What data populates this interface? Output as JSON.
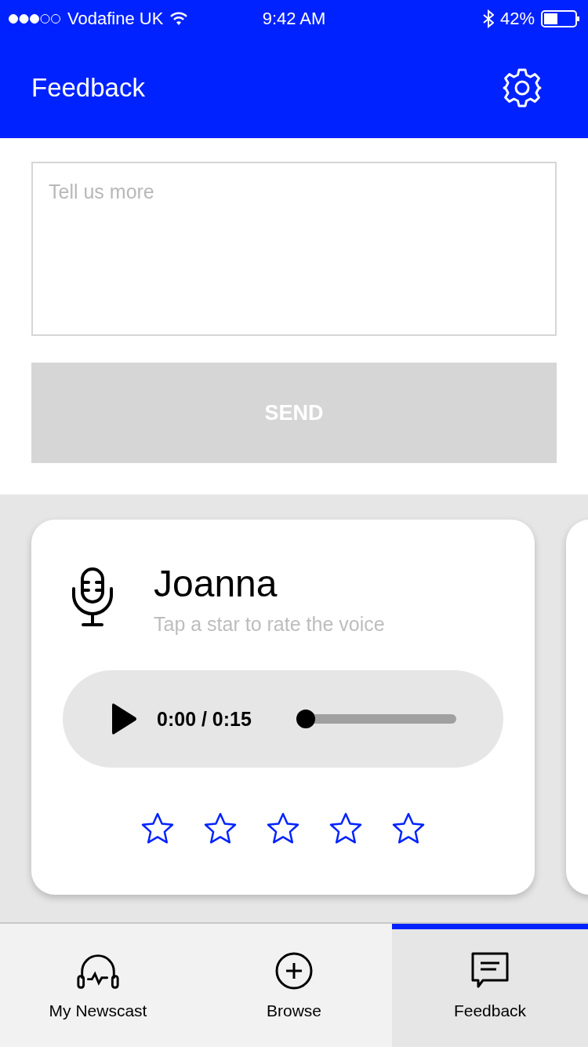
{
  "status_bar": {
    "carrier": "Vodafine UK",
    "time": "9:42 AM",
    "battery": "42%"
  },
  "header": {
    "title": "Feedback"
  },
  "feedback": {
    "placeholder": "Tell us more",
    "send": "SEND",
    "disabled": true
  },
  "voice_card": {
    "name": "Joanna",
    "hint": "Tap a star to rate the voice",
    "playing": false,
    "time": "0:00 / 0:15",
    "level": 0,
    "stars": 0
  },
  "tabs": [
    {
      "label": "My Newscast",
      "kind": "headphones",
      "selected": false
    },
    {
      "label": "Browse",
      "kind": "add",
      "selected": false
    },
    {
      "label": "Feedback",
      "kind": "chat",
      "selected": true
    }
  ]
}
